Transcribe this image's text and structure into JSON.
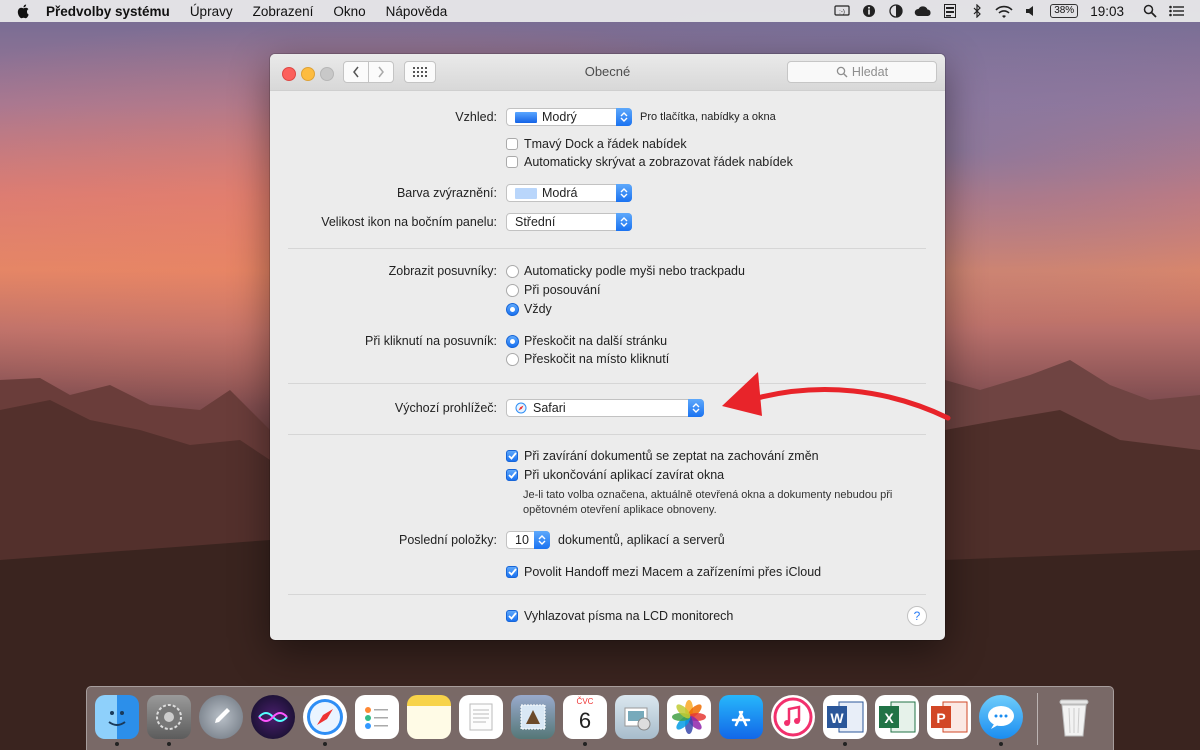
{
  "menubar": {
    "apple_icon": "apple-icon",
    "items": [
      "Předvolby systému",
      "Úpravy",
      "Zobrazení",
      "Okno",
      "Nápověda"
    ],
    "status_icons": [
      "display-icon",
      "info-icon",
      "contrast-icon",
      "cloud-icon",
      "menu-icon",
      "bluetooth-icon",
      "wifi-icon",
      "volume-icon"
    ],
    "battery": "38%",
    "clock": "19:03",
    "search_icon": "spotlight-icon",
    "list_icon": "notification-center-icon"
  },
  "window": {
    "title": "Obecné",
    "search_placeholder": "Hledat"
  },
  "appearance": {
    "label": "Vzhled:",
    "value": "Modrý",
    "hint": "Pro tlačítka, nabídky a okna",
    "dark_dock": "Tmavý Dock a řádek nabídek",
    "autohide_menu": "Automaticky skrývat a zobrazovat řádek nabídek"
  },
  "highlight": {
    "label": "Barva zvýraznění:",
    "value": "Modrá"
  },
  "sidebar_icons": {
    "label": "Velikost ikon na bočním panelu:",
    "value": "Střední"
  },
  "scrollbars": {
    "label": "Zobrazit posuvníky:",
    "options": [
      "Automaticky podle myši nebo trackpadu",
      "Při posouvání",
      "Vždy"
    ],
    "selected_index": 2
  },
  "scroll_click": {
    "label": "Při kliknutí na posuvník:",
    "options": [
      "Přeskočit na další stránku",
      "Přeskočit na místo kliknutí"
    ],
    "selected_index": 0
  },
  "browser": {
    "label": "Výchozí prohlížeč:",
    "value": "Safari"
  },
  "documents": {
    "ask_changes": "Při zavírání dokumentů se zeptat na zachování změn",
    "close_windows": "Při ukončování aplikací zavírat okna",
    "note": "Je-li tato volba označena, aktuálně otevřená okna a dokumenty nebudou při opětovném otevření aplikace obnoveny."
  },
  "recent": {
    "label": "Poslední položky:",
    "value": "10",
    "suffix": "dokumentů, aplikací a serverů"
  },
  "handoff": "Povolit Handoff mezi Macem a zařízeními přes iCloud",
  "lcd": "Vyhlazovat písma na LCD monitorech",
  "help": "?",
  "calendar": {
    "month": "ČVC",
    "day": "6"
  },
  "colors": {
    "accent": "#1a72f1",
    "arrow": "#e8242a"
  }
}
